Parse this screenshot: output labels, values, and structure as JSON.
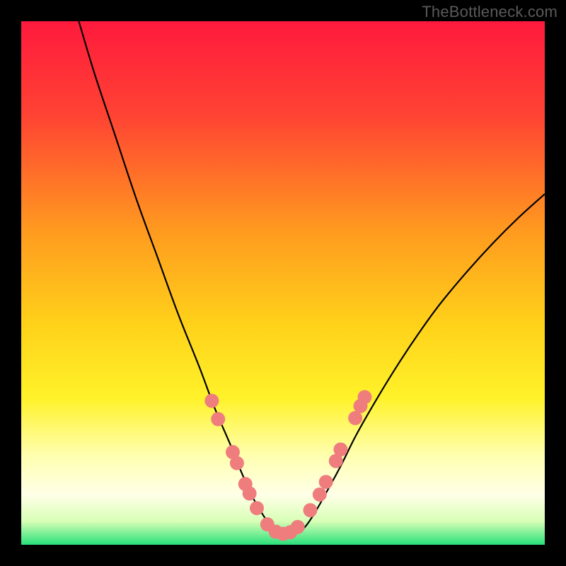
{
  "watermark": {
    "text": "TheBottleneck.com"
  },
  "chart_data": {
    "type": "line",
    "title": "",
    "xlabel": "",
    "ylabel": "",
    "xlim": [
      0,
      100
    ],
    "ylim": [
      0,
      100
    ],
    "background_gradient": {
      "stops": [
        {
          "offset": 0.0,
          "color": "#ff1a3d"
        },
        {
          "offset": 0.18,
          "color": "#ff4333"
        },
        {
          "offset": 0.4,
          "color": "#ff9a1f"
        },
        {
          "offset": 0.58,
          "color": "#ffd21a"
        },
        {
          "offset": 0.72,
          "color": "#fff22a"
        },
        {
          "offset": 0.83,
          "color": "#ffffb0"
        },
        {
          "offset": 0.905,
          "color": "#ffffe8"
        },
        {
          "offset": 0.955,
          "color": "#d8ffb6"
        },
        {
          "offset": 1.0,
          "color": "#28e07a"
        }
      ]
    },
    "series": [
      {
        "name": "bottleneck-curve",
        "color": "#000000",
        "x": [
          11.0,
          14.0,
          18.0,
          22.0,
          26.0,
          30.0,
          34.0,
          37.0,
          40.0,
          42.0,
          44.0,
          46.0,
          48.0,
          50.0,
          52.0,
          54.0,
          56.0,
          58.0,
          61.0,
          64.0,
          68.0,
          72.0,
          76.0,
          80.0,
          85.0,
          90.0,
          95.0,
          100.0
        ],
        "y": [
          100.0,
          90.0,
          78.0,
          66.0,
          55.0,
          44.0,
          34.0,
          26.0,
          19.0,
          14.0,
          9.5,
          6.0,
          3.2,
          2.2,
          2.2,
          3.2,
          6.0,
          9.5,
          15.0,
          21.0,
          28.0,
          34.5,
          40.5,
          46.0,
          52.0,
          57.5,
          62.5,
          67.0
        ]
      }
    ],
    "markers": {
      "color": "#ef7d7d",
      "radius_pct": 1.35,
      "points": [
        {
          "x": 36.4,
          "y": 27.5
        },
        {
          "x": 37.6,
          "y": 24.0
        },
        {
          "x": 40.4,
          "y": 17.7
        },
        {
          "x": 41.2,
          "y": 15.6
        },
        {
          "x": 42.8,
          "y": 11.6
        },
        {
          "x": 43.6,
          "y": 9.8
        },
        {
          "x": 45.0,
          "y": 7.0
        },
        {
          "x": 47.0,
          "y": 3.9
        },
        {
          "x": 48.6,
          "y": 2.5
        },
        {
          "x": 50.0,
          "y": 2.1
        },
        {
          "x": 51.4,
          "y": 2.4
        },
        {
          "x": 52.8,
          "y": 3.4
        },
        {
          "x": 55.2,
          "y": 6.6
        },
        {
          "x": 57.0,
          "y": 9.6
        },
        {
          "x": 58.2,
          "y": 12.0
        },
        {
          "x": 60.1,
          "y": 16.0
        },
        {
          "x": 61.0,
          "y": 18.2
        },
        {
          "x": 63.8,
          "y": 24.2
        },
        {
          "x": 64.8,
          "y": 26.5
        },
        {
          "x": 65.6,
          "y": 28.2
        }
      ]
    }
  }
}
